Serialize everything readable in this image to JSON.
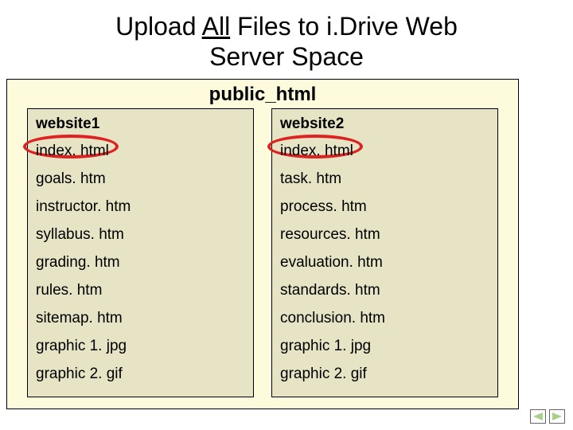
{
  "title": {
    "line1_pre": "Upload ",
    "line1_mid": "All",
    "line1_post": " Files to i.Drive Web",
    "line2": "Server Space"
  },
  "folder": {
    "name": "public_html",
    "sites": [
      {
        "name": "website1",
        "circle_index": 0,
        "files": [
          "index. html",
          "goals. htm",
          "instructor. htm",
          "syllabus. htm",
          "grading. htm",
          "rules. htm",
          "sitemap. htm",
          "graphic 1. jpg",
          "graphic 2. gif"
        ]
      },
      {
        "name": "website2",
        "circle_index": 0,
        "files": [
          "index. html",
          "task. htm",
          "process. htm",
          "resources. htm",
          "evaluation. htm",
          "standards. htm",
          "conclusion. htm",
          "graphic 1. jpg",
          "graphic 2. gif"
        ]
      }
    ]
  },
  "colors": {
    "accent_circle": "#d22",
    "outer_box_bg": "#fefbdd",
    "inner_box_bg": "#e6e4c4"
  }
}
